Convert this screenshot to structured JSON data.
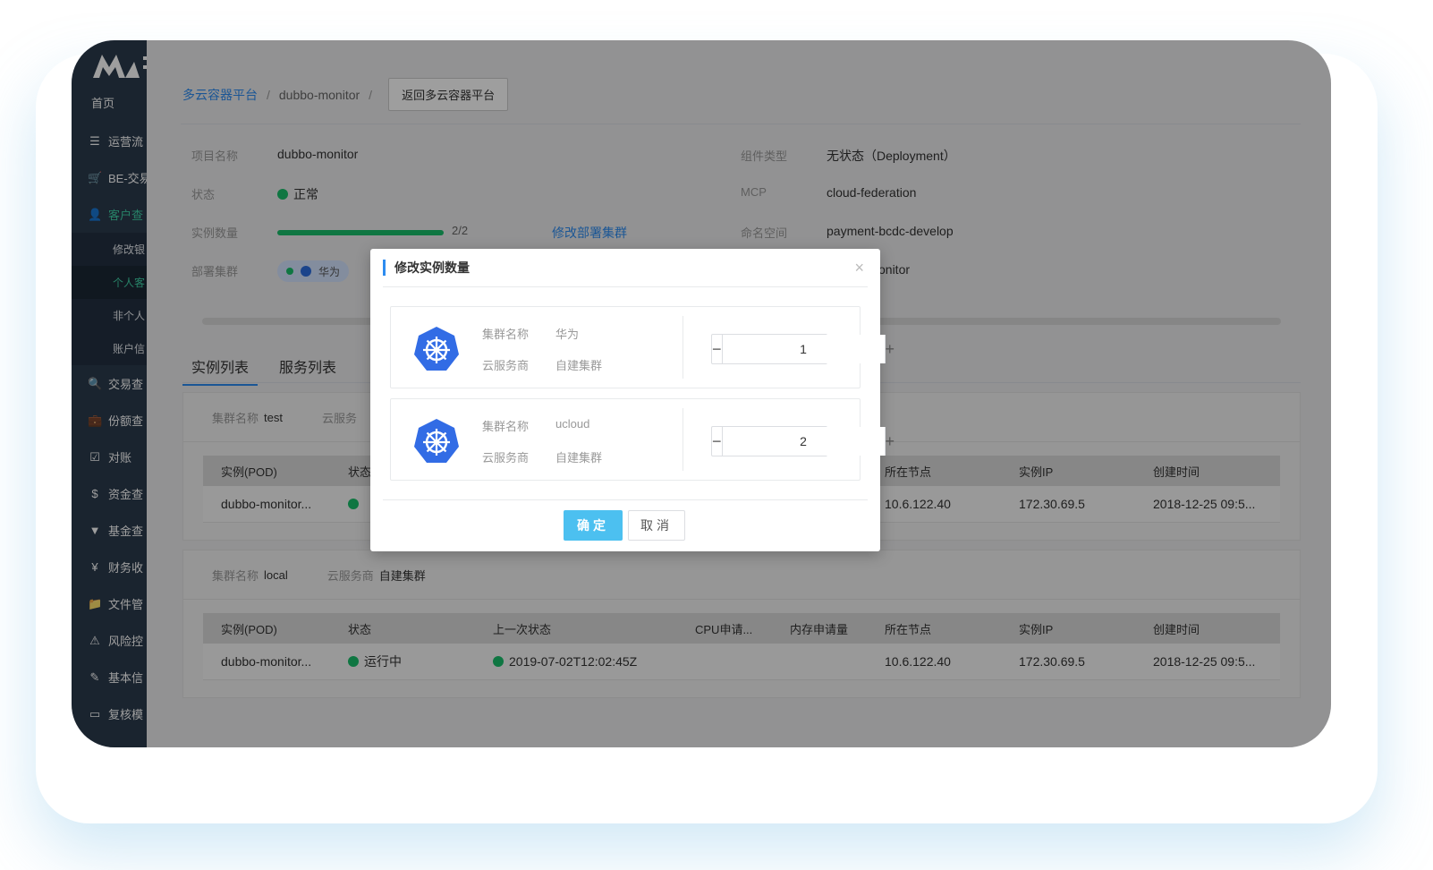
{
  "sidebar": {
    "home": "首页",
    "items": [
      {
        "icon": "list-icon",
        "glyph": "☰",
        "label": "运营流"
      },
      {
        "icon": "cart-icon",
        "glyph": "🛒",
        "label": "BE-交易"
      },
      {
        "icon": "user-icon",
        "glyph": "👤",
        "label": "客户查"
      }
    ],
    "submenu": [
      {
        "label": "修改银"
      },
      {
        "label": "个人客"
      },
      {
        "label": "非个人"
      },
      {
        "label": "账户信"
      }
    ],
    "items2": [
      {
        "icon": "search-icon",
        "glyph": "🔍",
        "label": "交易查"
      },
      {
        "icon": "briefcase-icon",
        "glyph": "💼",
        "label": "份额查"
      },
      {
        "icon": "checkbox-icon",
        "glyph": "☑",
        "label": "对账"
      },
      {
        "icon": "dollar-icon",
        "glyph": "$",
        "label": "资金查"
      },
      {
        "icon": "filter-icon",
        "glyph": "▼",
        "label": "基金查"
      },
      {
        "icon": "yen-icon",
        "glyph": "¥",
        "label": "财务收"
      },
      {
        "icon": "folder-icon",
        "glyph": "📁",
        "label": "文件管"
      },
      {
        "icon": "warning-icon",
        "glyph": "⚠",
        "label": "风险控"
      },
      {
        "icon": "pencil-icon",
        "glyph": "✎",
        "label": "基本信"
      },
      {
        "icon": "card-icon",
        "glyph": "▭",
        "label": "复核模"
      }
    ]
  },
  "breadcrumb": {
    "root": "多云容器平台",
    "sep": "/",
    "current": "dubbo-monitor",
    "back_label": "返回多云容器平台"
  },
  "info": {
    "project_label": "项目名称",
    "project_value": "dubbo-monitor",
    "status_label": "状态",
    "status_value": "正常",
    "instances_label": "实例数量",
    "instances_value": "2/2",
    "instances_progress": 1.0,
    "modify_link": "修改部署集群",
    "clusters_label": "部署集群",
    "cluster_tag": "华为",
    "component_label": "组件类型",
    "component_value": "无状态（Deployment）",
    "mcp_label": "MCP",
    "mcp_value": "cloud-federation",
    "namespace_label": "命名空间",
    "namespace_value": "payment-bcdc-develop",
    "extra_value": "onitor"
  },
  "tabs": [
    {
      "label": "实例列表",
      "active": true
    },
    {
      "label": "服务列表",
      "active": false
    }
  ],
  "cluster_test": {
    "name_label": "集群名称",
    "name_value": "test",
    "provider_label": "云服务",
    "headers": [
      "实例(POD)",
      "状态",
      "",
      "",
      "",
      "所在节点",
      "实例IP",
      "创建时间"
    ],
    "rows": [
      [
        "dubbo-monitor...",
        "",
        "",
        "",
        "",
        "10.6.122.40",
        "172.30.69.5",
        "2018-12-25 09:5..."
      ]
    ]
  },
  "cluster_local": {
    "name_label": "集群名称",
    "name_value": "local",
    "provider_label": "云服务商",
    "provider_value": "自建集群",
    "headers": [
      "实例(POD)",
      "状态",
      "上一次状态",
      "CPU申请...",
      "内存申请量",
      "所在节点",
      "实例IP",
      "创建时间"
    ],
    "rows": [
      [
        "dubbo-monitor...",
        "运行中",
        "2019-07-02T12:02:45Z",
        "",
        "",
        "10.6.122.40",
        "172.30.69.5",
        "2018-12-25 09:5..."
      ]
    ]
  },
  "modal": {
    "title": "修改实例数量",
    "close": "×",
    "clusters": [
      {
        "name_label": "集群名称",
        "name_value": "华为",
        "provider_label": "云服务商",
        "provider_value": "自建集群",
        "count": "1"
      },
      {
        "name_label": "集群名称",
        "name_value": "ucloud",
        "provider_label": "云服务商",
        "provider_value": "自建集群",
        "count": "2"
      }
    ],
    "minus": "−",
    "plus": "+",
    "ok": "确定",
    "cancel": "取消"
  },
  "colors": {
    "sidebar_bg": "#2b3a4c",
    "accent_blue": "#2d8cf0",
    "success_green": "#19be6b",
    "active_menu": "#3fd0a6",
    "ok_button": "#4cc0f0",
    "k8s_blue": "#326ce5"
  }
}
